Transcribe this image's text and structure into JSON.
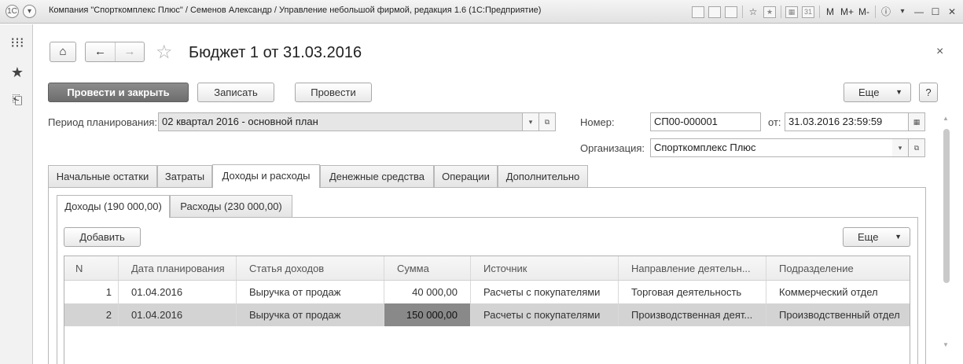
{
  "window": {
    "title": "Компания \"Спорткомплекс Плюс\" / Семенов Александр / Управление небольшой фирмой, редакция 1.6  (1С:Предприятие)",
    "m_labels": [
      "M",
      "M+",
      "M-"
    ]
  },
  "document": {
    "title": "Бюджет 1 от 31.03.2016",
    "close_glyph": "×"
  },
  "toolbar": {
    "post_and_close": "Провести и закрыть",
    "save": "Записать",
    "post": "Провести",
    "more": "Еще",
    "help": "?"
  },
  "form": {
    "period_label": "Период планирования:",
    "period_value": "02 квартал 2016 - основной план",
    "number_label": "Номер:",
    "number_value": "СП00-000001",
    "date_label": "от:",
    "date_value": "31.03.2016 23:59:59",
    "org_label": "Организация:",
    "org_value": "Спорткомплекс Плюс"
  },
  "tabs": [
    "Начальные остатки",
    "Затраты",
    "Доходы и расходы",
    "Денежные средства",
    "Операции",
    "Дополнительно"
  ],
  "active_tab": 2,
  "subtabs": [
    "Доходы (190 000,00)",
    "Расходы (230 000,00)"
  ],
  "active_subtab": 0,
  "table_toolbar": {
    "add": "Добавить",
    "more": "Еще"
  },
  "table": {
    "columns": [
      "N",
      "Дата планирования",
      "Статья доходов",
      "Сумма",
      "Источник",
      "Направление деятельн...",
      "Подразделение"
    ],
    "rows": [
      [
        "1",
        "01.04.2016",
        "Выручка от продаж",
        "40 000,00",
        "Расчеты с покупателями",
        "Торговая деятельность",
        "Коммерческий отдел"
      ],
      [
        "2",
        "01.04.2016",
        "Выручка от продаж",
        "150 000,00",
        "Расчеты с покупателями",
        "Производственная деят...",
        "Производственный отдел"
      ]
    ],
    "selected_row": 1
  },
  "colors": {
    "primary_button": "#7b7b7b",
    "selected_row": "#d3d3d3",
    "active_cell": "#898989"
  }
}
